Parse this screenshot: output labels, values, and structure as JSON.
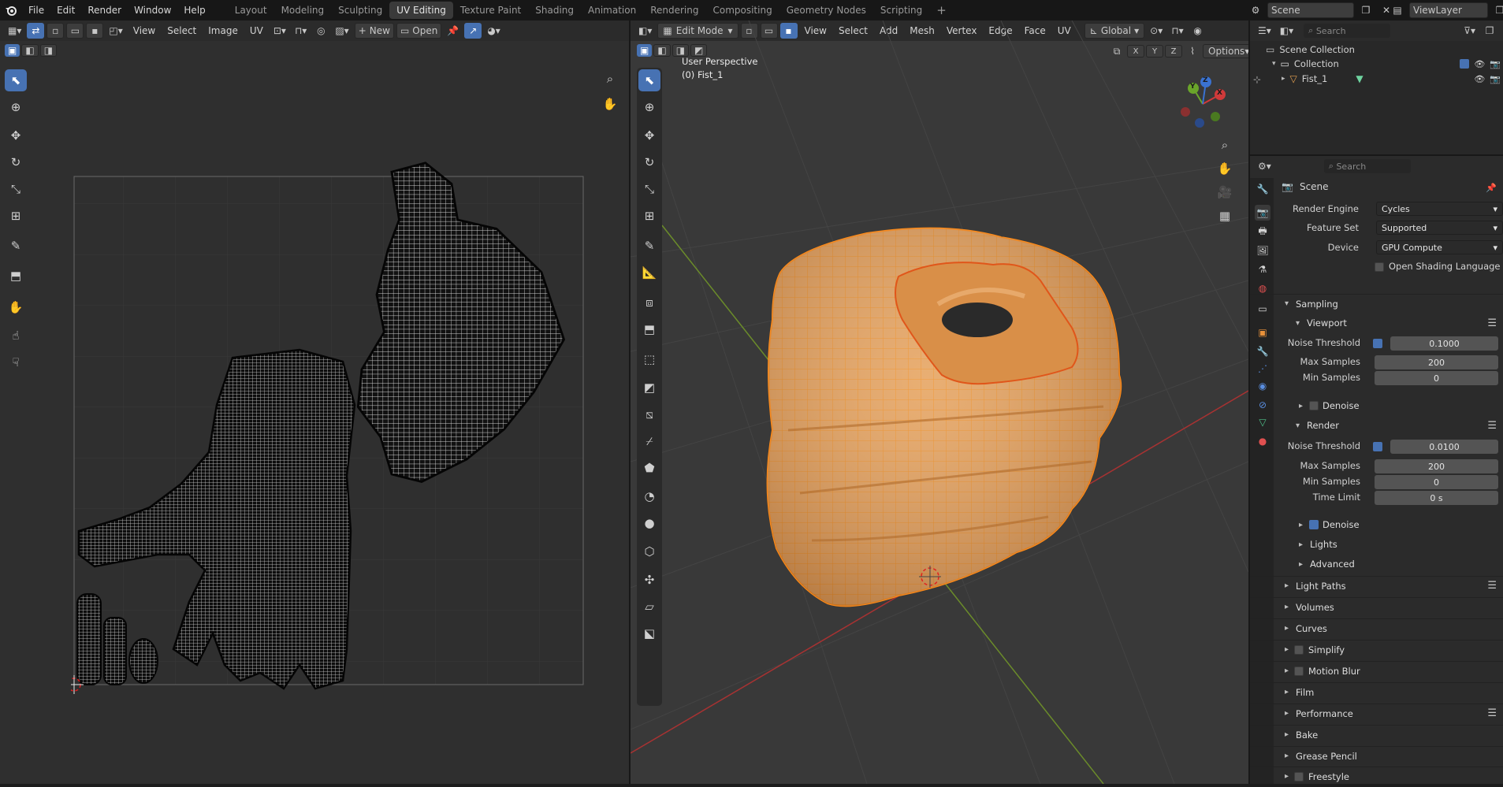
{
  "menu": {
    "items": [
      "File",
      "Edit",
      "Render",
      "Window",
      "Help"
    ],
    "workspaces": [
      "Layout",
      "Modeling",
      "Sculpting",
      "UV Editing",
      "Texture Paint",
      "Shading",
      "Animation",
      "Rendering",
      "Compositing",
      "Geometry Nodes",
      "Scripting"
    ],
    "active_workspace": "UV Editing",
    "scene_label": "Scene",
    "view_layer_label": "ViewLayer"
  },
  "uv_editor": {
    "menus": [
      "View",
      "Select",
      "Image",
      "UV"
    ],
    "new_label": "New",
    "open_label": "Open"
  },
  "viewport": {
    "mode": "Edit Mode",
    "menus": [
      "View",
      "Select",
      "Add",
      "Mesh",
      "Vertex",
      "Edge",
      "Face",
      "UV"
    ],
    "orientation": "Global",
    "axis_labels": [
      "X",
      "Y",
      "Z"
    ],
    "options_label": "Options",
    "overlay_title": "User Perspective",
    "overlay_object": "(0) Fist_1",
    "gizmo": {
      "x": "X",
      "y": "Y",
      "z": "Z"
    }
  },
  "outliner": {
    "search_placeholder": "Search",
    "scene_collection": "Scene Collection",
    "collection": "Collection",
    "object": "Fist_1"
  },
  "properties": {
    "search_placeholder": "Search",
    "title": "Scene",
    "render_engine_label": "Render Engine",
    "render_engine": "Cycles",
    "feature_set_label": "Feature Set",
    "feature_set": "Supported",
    "device_label": "Device",
    "device": "GPU Compute",
    "osl_label": "Open Shading Language",
    "sampling": "Sampling",
    "viewport": "Viewport",
    "render": "Render",
    "noise_threshold_label": "Noise Threshold",
    "vp_noise": "0.1000",
    "max_samples_label": "Max Samples",
    "vp_max": "200",
    "min_samples_label": "Min Samples",
    "vp_min": "0",
    "denoise_label": "Denoise",
    "r_noise": "0.0100",
    "r_max": "200",
    "r_min": "0",
    "time_limit_label": "Time Limit",
    "r_time": "0 s",
    "lights": "Lights",
    "advanced": "Advanced",
    "sections": [
      "Light Paths",
      "Volumes",
      "Curves",
      "Simplify",
      "Motion Blur",
      "Film",
      "Performance",
      "Bake",
      "Grease Pencil",
      "Freestyle"
    ]
  },
  "colors": {
    "accent": "#4772b3",
    "mesh": "#e8a153",
    "wire": "#ff8c1a"
  }
}
